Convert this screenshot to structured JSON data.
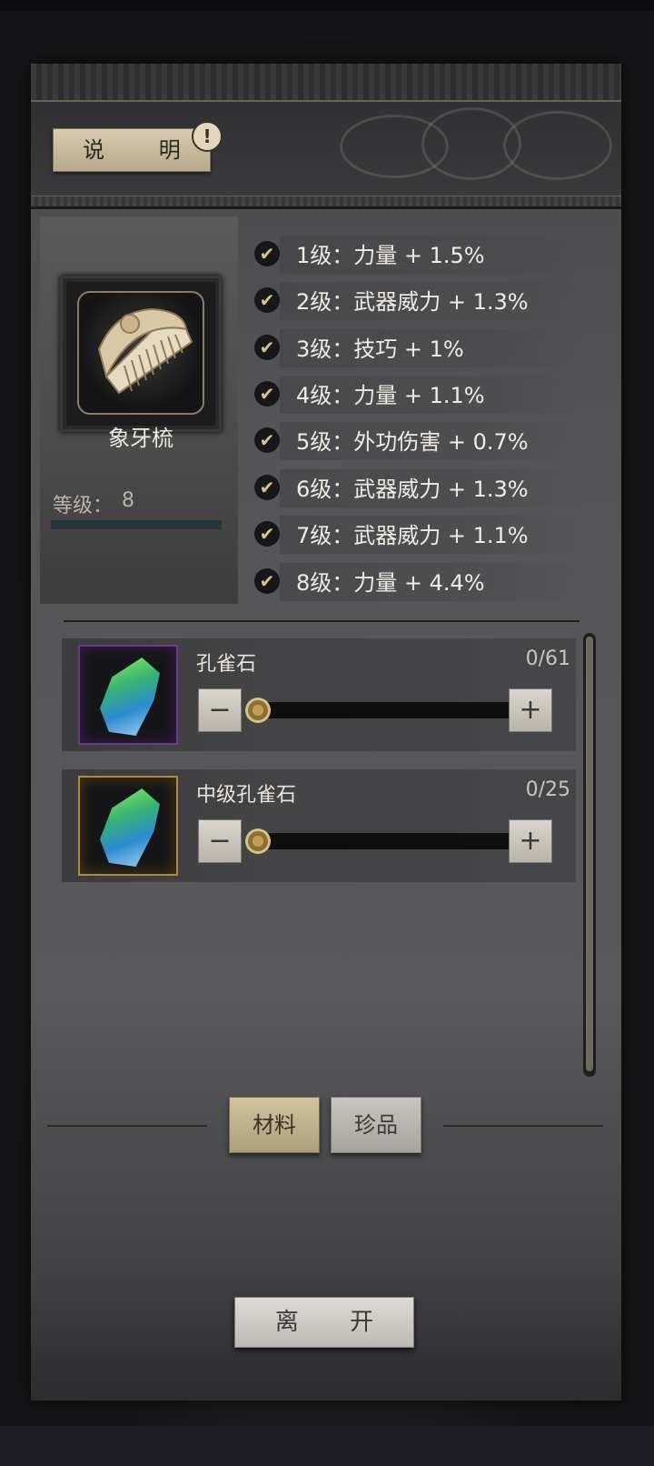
{
  "header": {
    "explain_label": "说 明",
    "info_icon": "!"
  },
  "item": {
    "name": "象牙梳",
    "level_label": "等级：",
    "level_value": "8"
  },
  "bonuses": [
    {
      "text": "1级：力量 + 1.5%",
      "checked": true
    },
    {
      "text": "2级：武器威力 + 1.3%",
      "checked": true
    },
    {
      "text": "3级：技巧 + 1%",
      "checked": true
    },
    {
      "text": "4级：力量 + 1.1%",
      "checked": true
    },
    {
      "text": "5级：外功伤害 + 0.7%",
      "checked": true
    },
    {
      "text": "6级：武器威力 + 1.3%",
      "checked": true
    },
    {
      "text": "7级：武器威力 + 1.1%",
      "checked": true
    },
    {
      "text": "8级：力量 + 4.4%",
      "checked": true
    }
  ],
  "materials": [
    {
      "name": "孔雀石",
      "count": "0/61",
      "frame": "purple",
      "slider_value": 0
    },
    {
      "name": "中级孔雀石",
      "count": "0/25",
      "frame": "gold",
      "slider_value": 0
    }
  ],
  "controls": {
    "minus_symbol": "−",
    "plus_symbol": "+",
    "check_symbol": "✔"
  },
  "tabs": [
    {
      "label": "材料",
      "active": true
    },
    {
      "label": "珍品",
      "active": false
    }
  ],
  "footer": {
    "leave_label": "离 开"
  }
}
